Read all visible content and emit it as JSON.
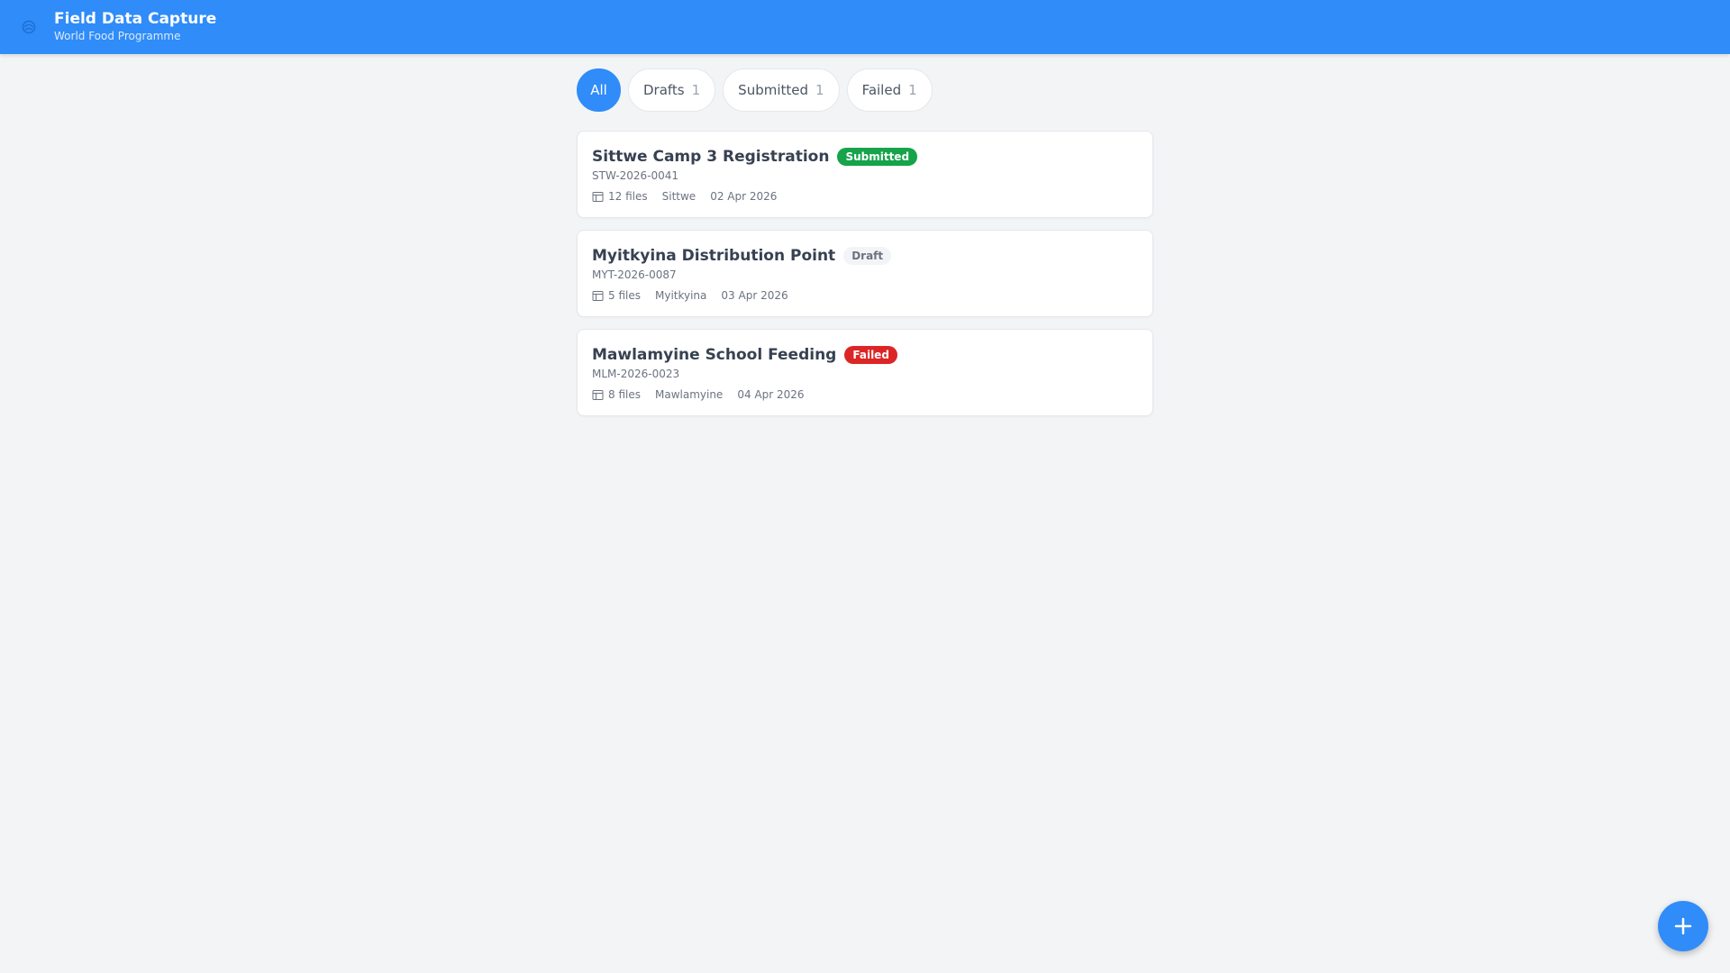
{
  "header": {
    "title": "Field Data Capture",
    "subtitle": "World Food Programme",
    "logo_icon": "wfp-globe-icon",
    "bg_color": "#2f8cf9"
  },
  "filters": [
    {
      "label": "All",
      "count": "",
      "active": true
    },
    {
      "label": "Drafts",
      "count": "1",
      "active": false
    },
    {
      "label": "Submitted",
      "count": "1",
      "active": false
    },
    {
      "label": "Failed",
      "count": "1",
      "active": false
    }
  ],
  "records": [
    {
      "title": "Sittwe Camp 3 Registration",
      "status": "Submitted",
      "status_color": "#16a34a",
      "id": "STW-2026-0041",
      "files": "12 files",
      "location": "Sittwe",
      "date": "02 Apr 2026"
    },
    {
      "title": "Myitkyina Distribution Point",
      "status": "Draft",
      "status_color": "#f3f4f6",
      "id": "MYT-2026-0087",
      "files": "5 files",
      "location": "Myitkyina",
      "date": "03 Apr 2026"
    },
    {
      "title": "Mawlamyine School Feeding",
      "status": "Failed",
      "status_color": "#dc2626",
      "id": "MLM-2026-0023",
      "files": "8 files",
      "location": "Mawlamyine",
      "date": "04 Apr 2026"
    }
  ],
  "fab": {
    "icon": "plus-icon"
  }
}
